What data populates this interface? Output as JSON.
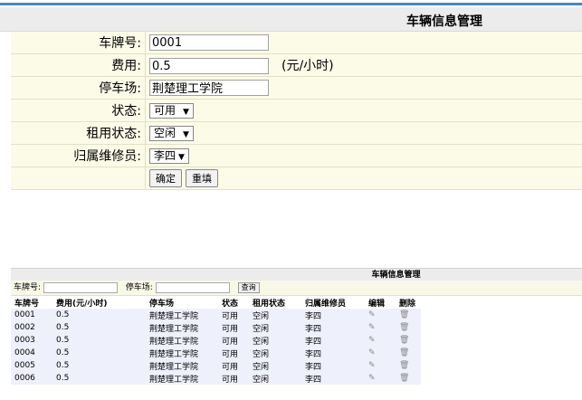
{
  "form": {
    "title": "车辆信息管理",
    "plate_label": "车牌号:",
    "plate_value": "0001",
    "fee_label": "费用:",
    "fee_value": "0.5",
    "fee_unit": "(元/小时)",
    "lot_label": "停车场:",
    "lot_value": "荆楚理工学院",
    "status_label": "状态:",
    "status_value": "可用",
    "rent_label": "租用状态:",
    "rent_value": "空闲",
    "owner_label": "归属维修员:",
    "owner_value": "李四",
    "ok_label": "确定",
    "reset_label": "重填"
  },
  "mini": {
    "title": "车辆信息管理",
    "plate_label": "车牌号:",
    "lot_label": "停车场:",
    "query_label": "查询",
    "headers": [
      "车牌号",
      "费用(元/小时)",
      "停车场",
      "状态",
      "租用状态",
      "归属维修员",
      "编辑",
      "删除"
    ],
    "rows": [
      [
        "0001",
        "0.5",
        "荆楚理工学院",
        "可用",
        "空闲",
        "李四"
      ],
      [
        "0002",
        "0.5",
        "荆楚理工学院",
        "可用",
        "空闲",
        "李四"
      ],
      [
        "0003",
        "0.5",
        "荆楚理工学院",
        "可用",
        "空闲",
        "李四"
      ],
      [
        "0004",
        "0.5",
        "荆楚理工学院",
        "可用",
        "空闲",
        "李四"
      ],
      [
        "0005",
        "0.5",
        "荆楚理工学院",
        "可用",
        "空闲",
        "李四"
      ],
      [
        "0006",
        "0.5",
        "荆楚理工学院",
        "可用",
        "空闲",
        "李四"
      ]
    ],
    "edit_icon": "✎",
    "delete_icon": "🗑"
  }
}
